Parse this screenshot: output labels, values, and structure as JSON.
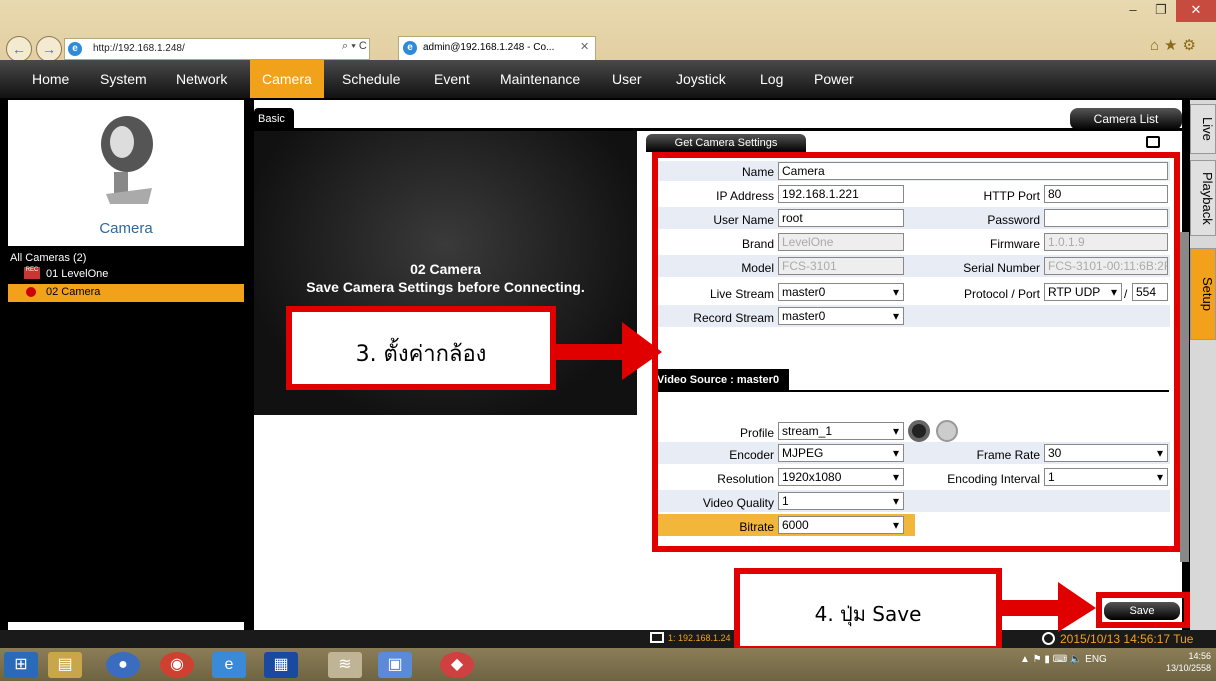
{
  "browser": {
    "url": "http://192.168.1.248/",
    "addr_controls": "⌕ ▾ C",
    "tab_title": "admin@192.168.1.248 - Co...",
    "close": "✕",
    "max": "❐",
    "min": "–",
    "toolbar_icons": "⌂★⚙"
  },
  "menu": [
    "Home",
    "System",
    "Network",
    "Camera",
    "Schedule",
    "Event",
    "Maintenance",
    "User",
    "Joystick",
    "Log",
    "Power"
  ],
  "sidebar": {
    "title": "Camera",
    "tree_root": "All Cameras (2)",
    "cameras": [
      "01  LevelOne",
      "02  Camera"
    ]
  },
  "right_tabs": [
    "Live",
    "Playback",
    "Setup"
  ],
  "panel": {
    "tab_basic": "Basic",
    "camera_list_btn": "Camera List",
    "video_msg1": "02 Camera",
    "video_msg2": "Save Camera Settings before Connecting.",
    "get_settings": "Get Camera Settings",
    "fields": {
      "name_label": "Name",
      "name": "Camera",
      "ip_label": "IP Address",
      "ip": "192.168.1.221",
      "http_label": "HTTP Port",
      "http": "80",
      "user_label": "User Name",
      "user": "root",
      "pass_label": "Password",
      "pass": "",
      "brand_label": "Brand",
      "brand": "LevelOne",
      "fw_label": "Firmware",
      "fw": "1.0.1.9",
      "model_label": "Model",
      "model": "FCS-3101",
      "serial_label": "Serial Number",
      "serial": "FCS-3101-00:11:6B:2F:",
      "live_label": "Live Stream",
      "live": "master0",
      "proto_label": "Protocol / Port",
      "proto": "RTP UDP",
      "slash": "/",
      "port": "554",
      "rec_label": "Record Stream",
      "rec": "master0"
    },
    "video_source_tab": "Video Source : master0",
    "vs": {
      "profile_label": "Profile",
      "profile": "stream_1",
      "encoder_label": "Encoder",
      "encoder": "MJPEG",
      "framerate_label": "Frame Rate",
      "framerate": "30",
      "res_label": "Resolution",
      "res": "1920x1080",
      "interval_label": "Encoding Interval",
      "interval": "1",
      "quality_label": "Video Quality",
      "quality": "1",
      "bitrate_label": "Bitrate",
      "bitrate": "6000"
    },
    "save": "Save"
  },
  "annotations": {
    "step3": "3. ตั้งค่ากล้อง",
    "step4": "4. ปุ่ม Save"
  },
  "status": {
    "ip": "1: 192.168.1.24",
    "datetime": "2015/10/13 14:56:17 Tue"
  },
  "taskbar": {
    "tray": "ENG",
    "time": "14:56",
    "date": "13/10/2558"
  },
  "colors": {
    "accent": "#f2a21a",
    "annotation": "#e00000"
  }
}
